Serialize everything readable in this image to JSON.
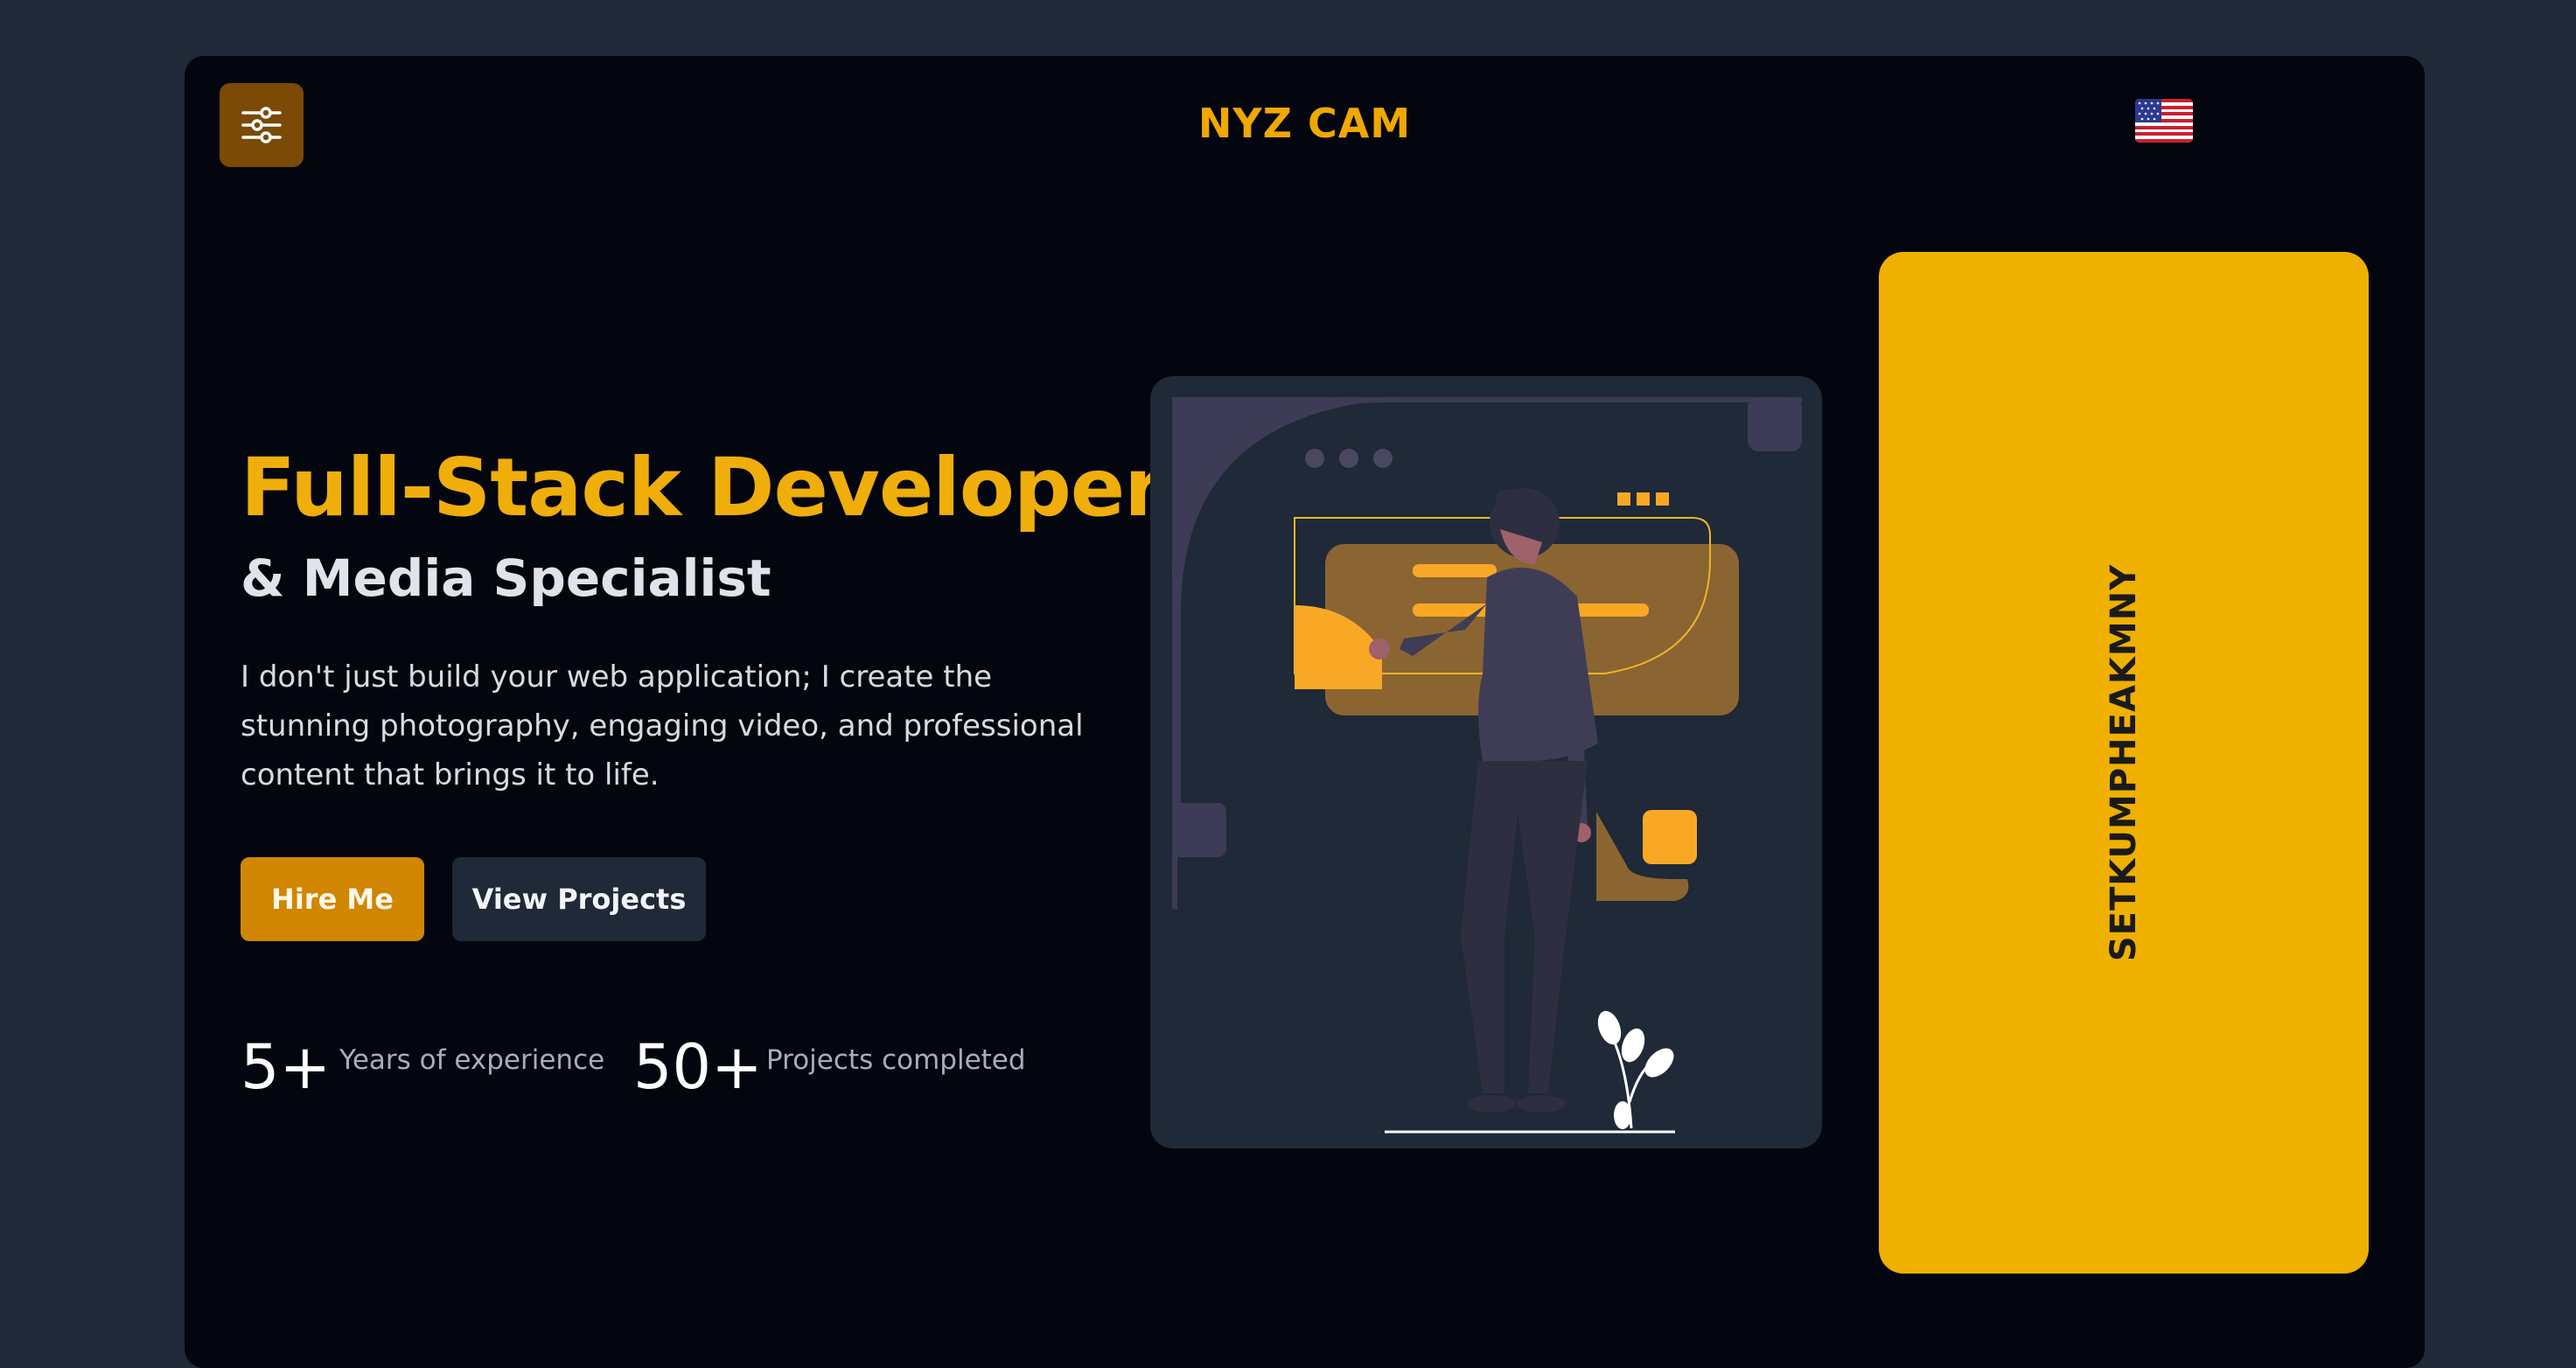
{
  "header": {
    "menu_icon": "sliders-icon",
    "brand": "NYZ CAM",
    "language_icon": "us-flag-icon"
  },
  "hero": {
    "title": "Full-Stack Developer",
    "subtitle": "& Media Specialist",
    "description": "I don't just build your web application; I create the stunning photography, engaging video, and professional content that brings it to life.",
    "hire_button": "Hire Me",
    "projects_button": "View Projects"
  },
  "stats": [
    {
      "value": "5+",
      "label": "Years of experience"
    },
    {
      "value": "50+",
      "label": "Projects completed"
    }
  ],
  "illustration": {
    "icon": "developer-presenting-illustration"
  },
  "side_panel": {
    "text": "SETKUMPHEAKMNY"
  },
  "colors": {
    "accent": "#f0ae0b",
    "background": "#03060e",
    "page_background": "#1f2937",
    "panel": "#efb000"
  }
}
